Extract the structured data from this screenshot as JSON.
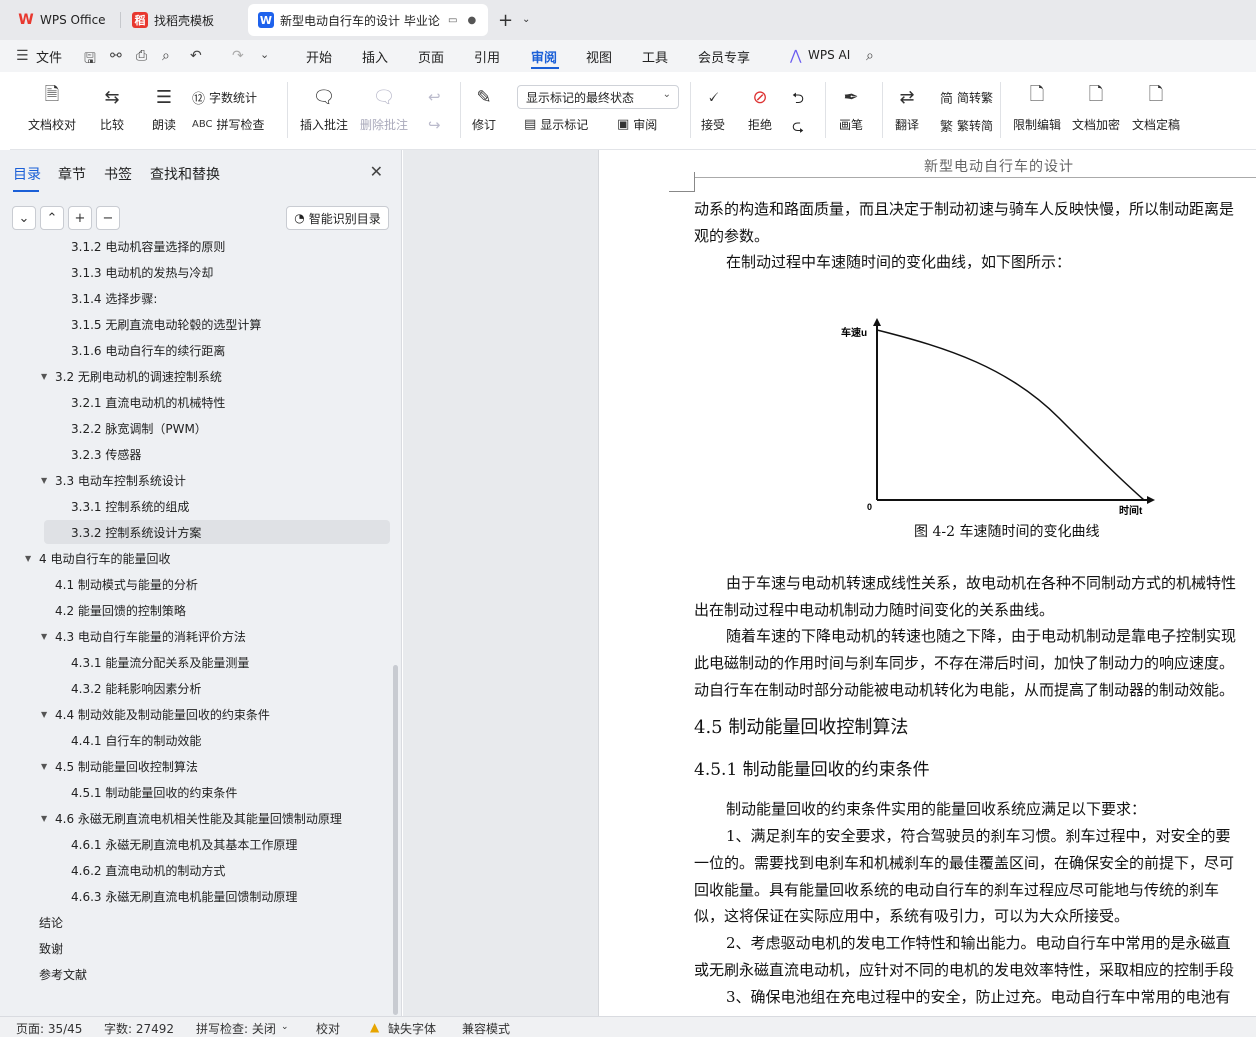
{
  "tabs": [
    {
      "label": "WPS Office",
      "icon": "wps-logo-icon"
    },
    {
      "label": "找稻壳模板",
      "icon": "docer-icon"
    },
    {
      "label": "新型电动自行车的设计 毕业论",
      "icon": "writer-icon"
    }
  ],
  "menu": {
    "file": "文件",
    "items": [
      "开始",
      "插入",
      "页面",
      "引用",
      "审阅",
      "视图",
      "工具",
      "会员专享"
    ],
    "active": "审阅",
    "ai": "WPS AI"
  },
  "ribbon": {
    "doc_check": "文档校对",
    "compare": "比较",
    "read_aloud": "朗读",
    "word_count": "字数统计",
    "spell_check": "拼写检查",
    "insert_comment": "插入批注",
    "delete_comment": "删除批注",
    "track": "修订",
    "markup_select": "显示标记的最终状态",
    "show_markup": "显示标记",
    "review": "审阅",
    "accept": "接受",
    "reject": "拒绝",
    "pen": "画笔",
    "translate": "翻译",
    "to_traditional": "简转繁",
    "to_simplified": "繁转简",
    "restrict": "限制编辑",
    "encrypt": "文档加密",
    "finalize": "文档定稿"
  },
  "nav": {
    "tabs": [
      "目录",
      "章节",
      "书签",
      "查找和替换"
    ],
    "smart_toc": "智能识别目录",
    "toc": [
      {
        "text": "3.1.2  电动机容量选择的原则",
        "level": 3
      },
      {
        "text": "3.1.3  电动机的发热与冷却",
        "level": 3
      },
      {
        "text": "3.1.4  选择步骤:",
        "level": 3
      },
      {
        "text": "3.1.5  无刷直流电动轮毂的选型计算",
        "level": 3
      },
      {
        "text": "3.1.6  电动自行车的续行距离",
        "level": 3
      },
      {
        "text": "3.2  无刷电动机的调速控制系统",
        "level": 2
      },
      {
        "text": "3.2.1  直流电动机的机械特性",
        "level": 3
      },
      {
        "text": "3.2.2  脉宽调制（PWM）",
        "level": 3
      },
      {
        "text": "3.2.3  传感器",
        "level": 3
      },
      {
        "text": "3.3  电动车控制系统设计",
        "level": 2
      },
      {
        "text": "3.3.1  控制系统的组成",
        "level": 3
      },
      {
        "text": "3.3.2  控制系统设计方案",
        "level": 3
      },
      {
        "text": "4  电动自行车的能量回收",
        "level": 1
      },
      {
        "text": "4.1  制动模式与能量的分析",
        "level": 2
      },
      {
        "text": "4.2  能量回馈的控制策略",
        "level": 2
      },
      {
        "text": "4.3  电动自行车能量的消耗评价方法",
        "level": 2
      },
      {
        "text": "4.3.1  能量流分配关系及能量测量",
        "level": 3
      },
      {
        "text": "4.3.2  能耗影响因素分析",
        "level": 3
      },
      {
        "text": "4.4  制动效能及制动能量回收的约束条件",
        "level": 2
      },
      {
        "text": "4.4.1  自行车的制动效能",
        "level": 3
      },
      {
        "text": "4.5  制动能量回收控制算法",
        "level": 2
      },
      {
        "text": "4.5.1  制动能量回收的约束条件",
        "level": 3
      },
      {
        "text": "4.6  永磁无刷直流电机相关性能及其能量回馈制动原理",
        "level": 2
      },
      {
        "text": "4.6.1  永磁无刷直流电机及其基本工作原理",
        "level": 3
      },
      {
        "text": "4.6.2  直流电动机的制动方式",
        "level": 3
      },
      {
        "text": "4.6.3  永磁无刷直流电机能量回馈制动原理",
        "level": 3
      },
      {
        "text": "结论",
        "level": 0
      },
      {
        "text": "致谢",
        "level": 0
      },
      {
        "text": "参考文献",
        "level": 0
      }
    ],
    "selected_index": 11
  },
  "doc": {
    "header": "新型电动自行车的设计",
    "p1": "动系的构造和路面质量，而且决定于制动初速与骑车人反映快慢，所以制动距离是",
    "p2": "观的参数。",
    "p3": "在制动过程中车速随时间的变化曲线，如下图所示：",
    "figure": {
      "ylabel": "车速u",
      "xlabel": "时间t",
      "origin": "0",
      "caption": "图 4-2  车速随时间的变化曲线"
    },
    "p4": "由于车速与电动机转速成线性关系，故电动机在各种不同制动方式的机械特性",
    "p5": "出在制动过程中电动机制动力随时间变化的关系曲线。",
    "p6": "随着车速的下降电动机的转速也随之下降，由于电动机制动是靠电子控制实现",
    "p7": "此电磁制动的作用时间与刹车同步，不存在滞后时间，加快了制动力的响应速度。",
    "p8": "动自行车在制动时部分动能被电动机转化为电能，从而提高了制动器的制动效能。",
    "h1": "4.5  制动能量回收控制算法",
    "h2": "4.5.1  制动能量回收的约束条件",
    "p9": "制动能量回收的约束条件实用的能量回收系统应满足以下要求：",
    "p10": "1、满足刹车的安全要求，符合驾驶员的刹车习惯。刹车过程中，对安全的要",
    "p11": "一位的。需要找到电刹车和机械刹车的最佳覆盖区间，在确保安全的前提下，尽可",
    "p12": "回收能量。具有能量回收系统的电动自行车的刹车过程应尽可能地与传统的刹车",
    "p13": "似，这将保证在实际应用中，系统有吸引力，可以为大众所接受。",
    "p14": "2、考虑驱动电机的发电工作特性和输出能力。电动自行车中常用的是永磁直",
    "p15": "或无刷永磁直流电动机，应针对不同的电机的发电效率特性，采取相应的控制手段",
    "p16": "3、确保电池组在充电过程中的安全，防止过充。电动自行车中常用的电池有"
  },
  "status": {
    "page": "页面: 35/45",
    "words": "字数: 27492",
    "spell": "拼写检查: 关闭",
    "proof": "校对",
    "missing_font": "缺失字体",
    "compat": "兼容模式"
  },
  "colors": {
    "accent": "#1a5fd7",
    "wps_red": "#e8382f",
    "writer_blue": "#1e62ec"
  }
}
